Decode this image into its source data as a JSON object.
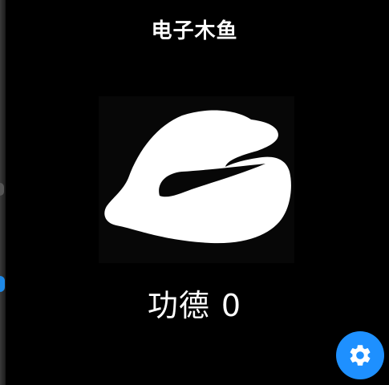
{
  "app": {
    "title": "电子木鱼"
  },
  "merit": {
    "label": "功德",
    "count": "0"
  },
  "woodfish": {
    "icon": "wooden-fish-icon"
  },
  "settings": {
    "icon": "gear-icon",
    "color": "#1e90ff"
  },
  "theme": {
    "background": "#000000",
    "text": "#ffffff"
  }
}
